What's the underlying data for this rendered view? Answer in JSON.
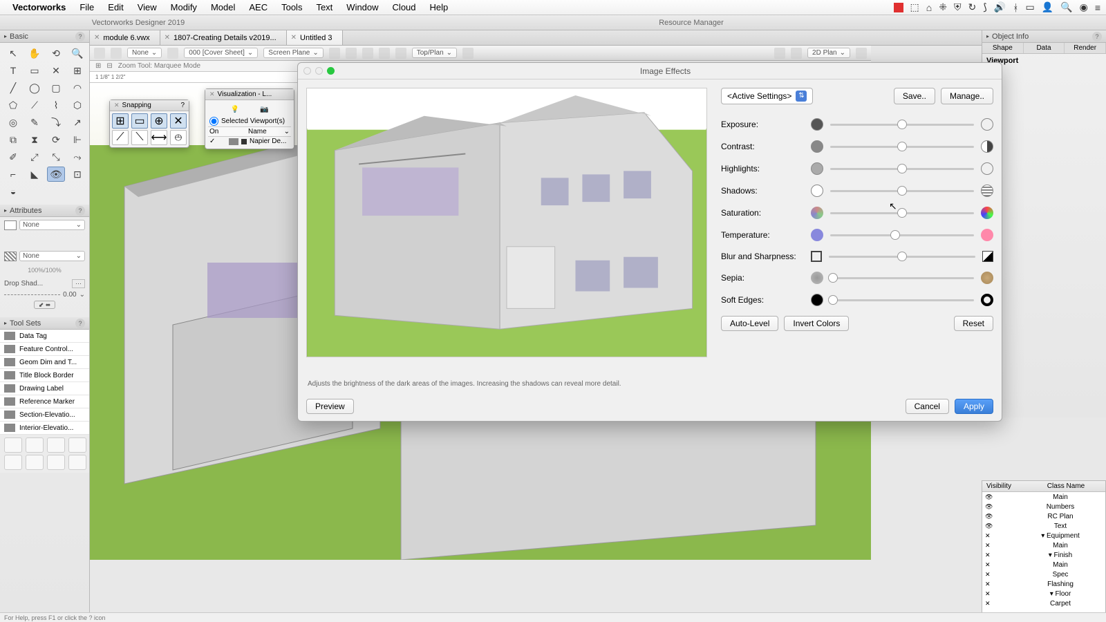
{
  "menubar": {
    "app": "Vectorworks",
    "items": [
      "File",
      "Edit",
      "View",
      "Modify",
      "Model",
      "AEC",
      "Tools",
      "Text",
      "Window",
      "Cloud",
      "Help"
    ]
  },
  "doc_titles": {
    "left": "Vectorworks Designer 2019",
    "center": "Resource Manager"
  },
  "tabs": [
    {
      "label": "module 6.vwx",
      "active": false
    },
    {
      "label": "1807-Creating Details v2019...",
      "active": false
    },
    {
      "label": "Untitled 3",
      "active": true
    }
  ],
  "viewbar": {
    "sel1": "None",
    "sel2": "000 [Cover Sheet]",
    "sel3": "Screen Plane",
    "sel4": "Top/Plan",
    "sel5": "2D Plan"
  },
  "zoom_bar": {
    "mode": "Zoom Tool: Marquee Mode"
  },
  "ruler": {
    "marks": "1 1/8\"            1 2/2\""
  },
  "left": {
    "basic_title": "Basic",
    "attributes_title": "Attributes",
    "attr_none": "None",
    "attr_pct": "100%/100%",
    "drop_shadow": "Drop Shad...",
    "drop_val": "0.00",
    "toolsets_title": "Tool Sets",
    "toolsets": [
      "Data Tag",
      "Feature Control...",
      "Geom Dim and T...",
      "Title Block Border",
      "Drawing Label",
      "Reference Marker",
      "Section-Elevatio...",
      "Interior-Elevatio..."
    ]
  },
  "snapping": {
    "title": "Snapping"
  },
  "visualization": {
    "title": "Visualization - L...",
    "scope": "Selected Viewport(s)",
    "col_on": "On",
    "col_name": "Name",
    "row1": "Napier De..."
  },
  "object_info": {
    "title": "Object Info",
    "tabs": [
      "Shape",
      "Data",
      "Render"
    ],
    "section": "Viewport"
  },
  "class_panel": {
    "col_vis": "Visibility",
    "col_name": "Class Name",
    "rows": [
      {
        "name": "Main",
        "vis": "eye"
      },
      {
        "name": "Numbers",
        "vis": "eye"
      },
      {
        "name": "RC Plan",
        "vis": "eye"
      },
      {
        "name": "Text",
        "vis": "eye"
      },
      {
        "name": "Equipment",
        "vis": "x",
        "group": true
      },
      {
        "name": "Main",
        "vis": "x"
      },
      {
        "name": "Finish",
        "vis": "x",
        "group": true
      },
      {
        "name": "Main",
        "vis": "x"
      },
      {
        "name": "Spec",
        "vis": "x"
      },
      {
        "name": "Flashing",
        "vis": "x"
      },
      {
        "name": "Floor",
        "vis": "x",
        "group": true
      },
      {
        "name": "Carpet",
        "vis": "x"
      }
    ]
  },
  "dialog": {
    "title": "Image Effects",
    "preset": "<Active Settings>",
    "save": "Save..",
    "manage": "Manage..",
    "sliders": [
      {
        "label": "Exposure:",
        "pos": 50,
        "left_fill": "#555",
        "right_style": "circle"
      },
      {
        "label": "Contrast:",
        "pos": 50,
        "left_fill": "#888",
        "right_style": "half"
      },
      {
        "label": "Highlights:",
        "pos": 50,
        "left_fill": "#aaa",
        "right_style": "circle"
      },
      {
        "label": "Shadows:",
        "pos": 50,
        "left_fill": "#fff",
        "right_style": "stripes"
      },
      {
        "label": "Saturation:",
        "pos": 50,
        "left_fill": "multi",
        "right_style": "multi"
      },
      {
        "label": "Temperature:",
        "pos": 45,
        "left_fill": "blue",
        "right_style": "pink"
      },
      {
        "label": "Blur and Sharpness:",
        "pos": 50,
        "left_fill": "square",
        "right_style": "square"
      },
      {
        "label": "Sepia:",
        "pos": 2,
        "left_fill": "gray3",
        "right_style": "brown3"
      },
      {
        "label": "Soft Edges:",
        "pos": 2,
        "left_fill": "#000",
        "right_style": "blackring"
      }
    ],
    "auto_level": "Auto-Level",
    "invert": "Invert Colors",
    "reset": "Reset",
    "hint": "Adjusts the brightness of the dark areas of the images. Increasing the shadows can reveal more detail.",
    "preview": "Preview",
    "cancel": "Cancel",
    "apply": "Apply"
  },
  "status": "For Help, press F1 or click the ? icon"
}
